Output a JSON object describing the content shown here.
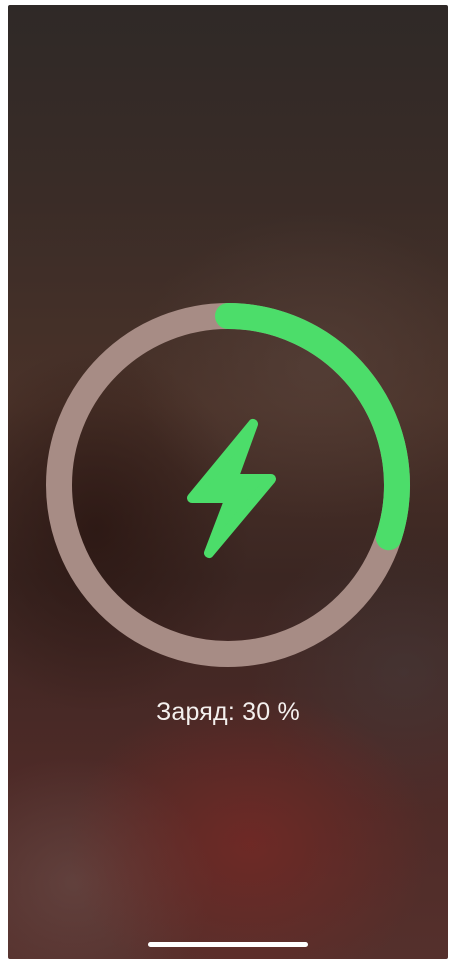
{
  "battery": {
    "label": "Заряд: 30 %",
    "level": 0.3
  },
  "icons": {
    "center": "lightning-bolt-icon"
  },
  "colors": {
    "progress": "#4cdd6a",
    "track": "#a78c85",
    "bolt": "#4cdd6a",
    "text": "#f4f0ee",
    "home_indicator": "#ffffff"
  }
}
